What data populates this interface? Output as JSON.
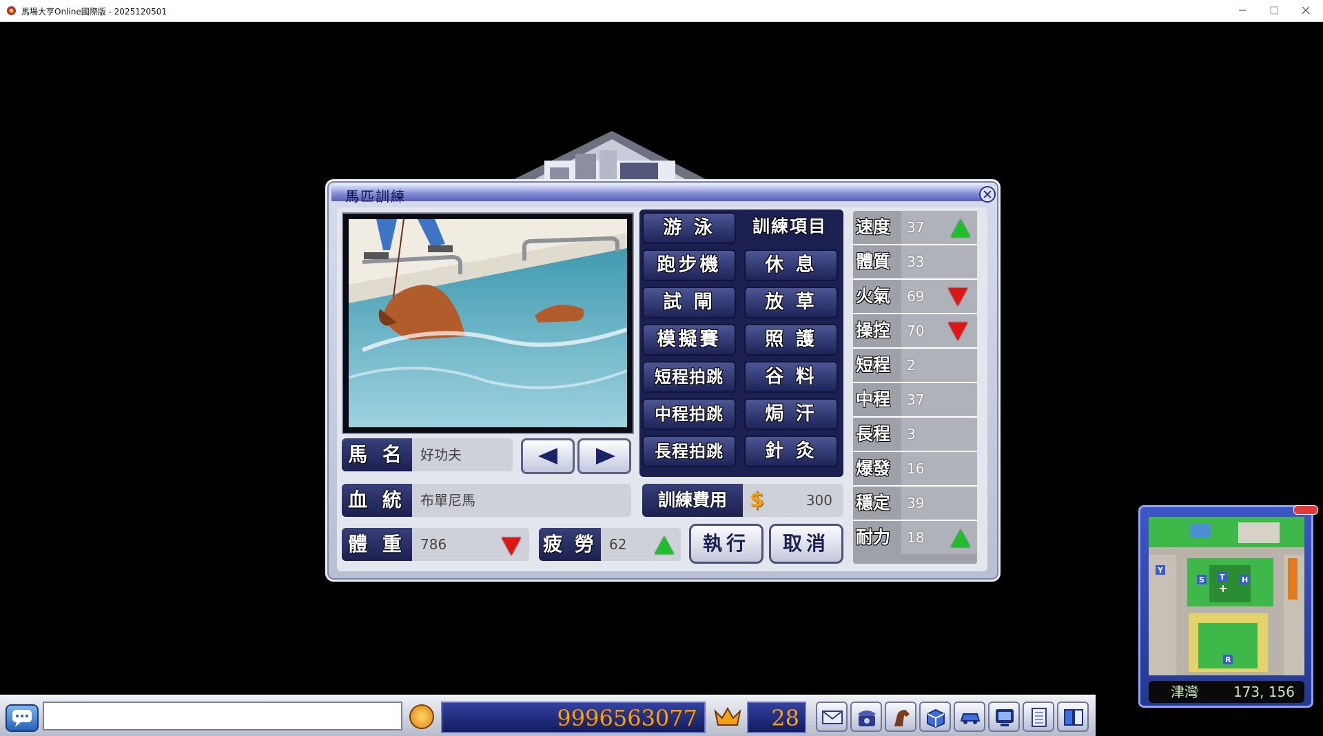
{
  "window": {
    "title": "馬場大亨Online國際版 - 2025120501"
  },
  "dialog": {
    "title": "馬匹訓練",
    "horse_name_label": "馬 名",
    "horse_name": "好功夫",
    "breed_label": "血 統",
    "breed": "布單尼馬",
    "weight_label": "體 重",
    "weight": "786",
    "weight_trend": "down",
    "fatigue_label": "疲 勞",
    "fatigue": "62",
    "fatigue_trend": "up",
    "cost_label": "訓練費用",
    "cost": "300",
    "execute_label": "執行",
    "cancel_label": "取消",
    "training_header": "訓練項目",
    "training_items": [
      "游 泳",
      "跑步機",
      "休 息",
      "試 閘",
      "放 草",
      "模擬賽",
      "照 護",
      "短程拍跳",
      "谷 料",
      "中程拍跳",
      "焗 汗",
      "長程拍跳",
      "針 灸"
    ],
    "stats": [
      {
        "name": "速度",
        "value": "37",
        "trend": "up"
      },
      {
        "name": "體質",
        "value": "33",
        "trend": ""
      },
      {
        "name": "火氣",
        "value": "69",
        "trend": "down"
      },
      {
        "name": "操控",
        "value": "70",
        "trend": "down"
      },
      {
        "name": "短程",
        "value": "2",
        "trend": ""
      },
      {
        "name": "中程",
        "value": "37",
        "trend": ""
      },
      {
        "name": "長程",
        "value": "3",
        "trend": ""
      },
      {
        "name": "爆發",
        "value": "16",
        "trend": ""
      },
      {
        "name": "穩定",
        "value": "39",
        "trend": ""
      },
      {
        "name": "耐力",
        "value": "18",
        "trend": "up"
      }
    ]
  },
  "minimap": {
    "location": "津灣",
    "coords": "173, 156",
    "markers": [
      "Y",
      "S",
      "T",
      "H",
      "R"
    ]
  },
  "bottombar": {
    "money": "9996563077",
    "level": "28",
    "tools": [
      "mail-icon",
      "telephone-icon",
      "horse-icon",
      "box-icon",
      "car-icon",
      "monitor-icon",
      "notebook-icon",
      "book-icon"
    ]
  },
  "colors": {
    "up": "#1fbf2a",
    "down": "#e01616",
    "accent": "#f7a11b",
    "panel_blue": "#1c2050"
  }
}
